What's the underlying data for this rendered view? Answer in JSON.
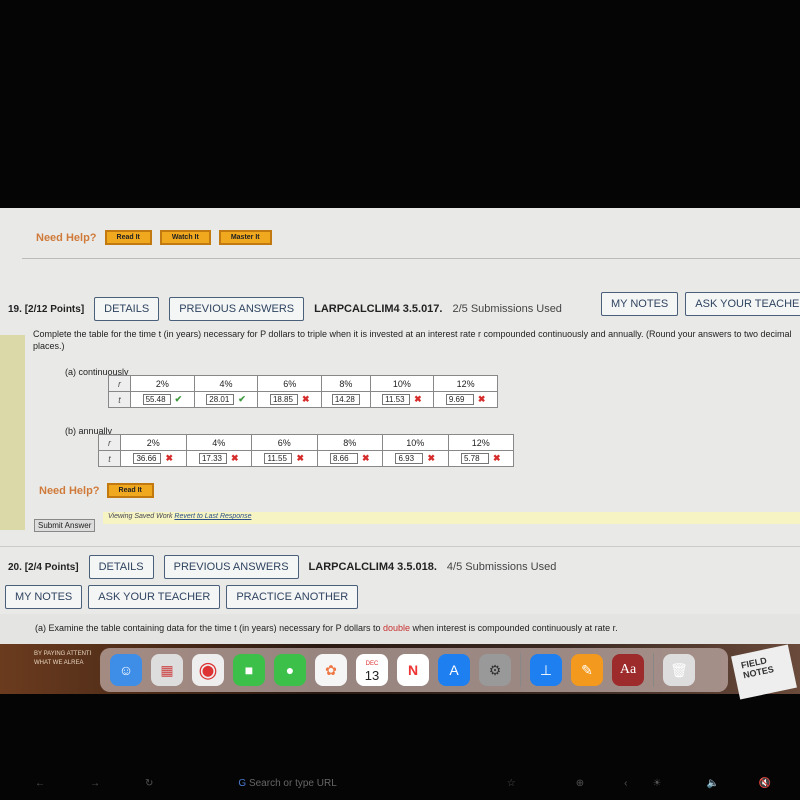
{
  "prev": {
    "need_help": "Need Help?",
    "read": "Read It",
    "watch": "Watch It",
    "master": "Master It"
  },
  "q19": {
    "number": "19.",
    "points": "[2/12 Points]",
    "details": "DETAILS",
    "previous": "PREVIOUS ANSWERS",
    "code": "LARPCALCLIM4 3.5.017.",
    "submissions": "2/5 Submissions Used",
    "my_notes": "MY NOTES",
    "ask": "ASK YOUR TEACHER",
    "prompt": "Complete the table for the time t (in years) necessary for P dollars to triple when it is invested at an interest rate r compounded continuously and annually. (Round your answers to two decimal places.)",
    "a_label": "(a) continuously",
    "b_label": "(b) annually",
    "r": "r",
    "t": "t",
    "rates": [
      "2%",
      "4%",
      "6%",
      "8%",
      "10%",
      "12%"
    ],
    "a_values": [
      {
        "v": "55.48",
        "ok": true
      },
      {
        "v": "28.01",
        "ok": true
      },
      {
        "v": "18.85",
        "ok": false
      },
      {
        "v": "14.28",
        "ok": null
      },
      {
        "v": "11.53",
        "ok": false
      },
      {
        "v": "9.69",
        "ok": false
      }
    ],
    "b_values": [
      {
        "v": "36.66",
        "ok": false
      },
      {
        "v": "17.33",
        "ok": false
      },
      {
        "v": "11.55",
        "ok": false
      },
      {
        "v": "8.66",
        "ok": false
      },
      {
        "v": "6.93",
        "ok": false
      },
      {
        "v": "5.78",
        "ok": false
      }
    ],
    "need_help": "Need Help?",
    "read": "Read It",
    "submit": "Submit Answer",
    "saved": "Viewing Saved Work",
    "revert": "Revert to Last Response"
  },
  "q20": {
    "number": "20.",
    "points": "[2/4 Points]",
    "details": "DETAILS",
    "previous": "PREVIOUS ANSWERS",
    "code": "LARPCALCLIM4 3.5.018.",
    "submissions": "4/5 Submissions Used",
    "my_notes": "MY NOTES",
    "ask": "ASK YOUR TEACHER",
    "practice": "PRACTICE ANOTHER",
    "prompt_a": "(a) Examine the table containing data for the time t (in years) necessary for P dollars to ",
    "prompt_red": "double",
    "prompt_b": " when interest is compounded continuously at rate r."
  },
  "dock": {
    "calendar_month": "DEC",
    "calendar_day": "13",
    "dictionary": "Aa"
  },
  "wallpaper": {
    "left_text": "BY PAYING ATTENTI WHAT WE ALREA",
    "right_text": "FIELD NOTES"
  },
  "touchbar": {
    "search": "Search or type URL"
  }
}
